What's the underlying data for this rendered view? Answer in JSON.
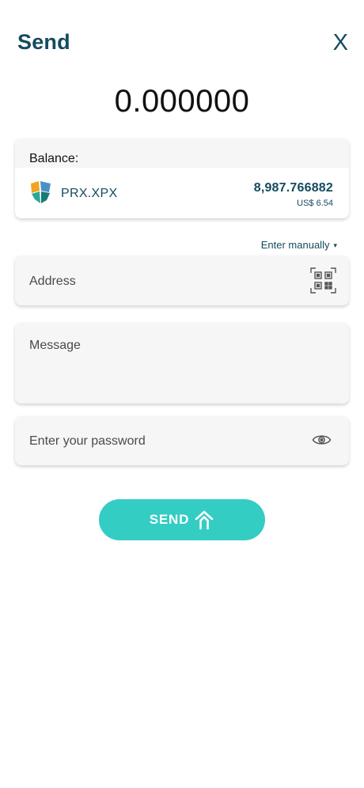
{
  "header": {
    "title": "Send",
    "close_label": "X"
  },
  "amount": "0.000000",
  "balance": {
    "label": "Balance:",
    "token": {
      "name": "PRX.XPX",
      "amount": "8,987.766882",
      "fiat": "US$ 6.54",
      "icon": "xpx-token-logo"
    }
  },
  "address_mode": {
    "label": "Enter manually",
    "caret": "▾"
  },
  "form": {
    "address_placeholder": "Address",
    "message_placeholder": "Message",
    "password_placeholder": "Enter your password",
    "address_icon": "qr-scan-icon",
    "password_icon": "eye-icon"
  },
  "send_button": {
    "label": "SEND",
    "icon": "send-arrow-icon"
  },
  "colors": {
    "primary_text": "#134b5f",
    "accent": "#34cdc3",
    "card_bg": "#f6f6f6"
  }
}
